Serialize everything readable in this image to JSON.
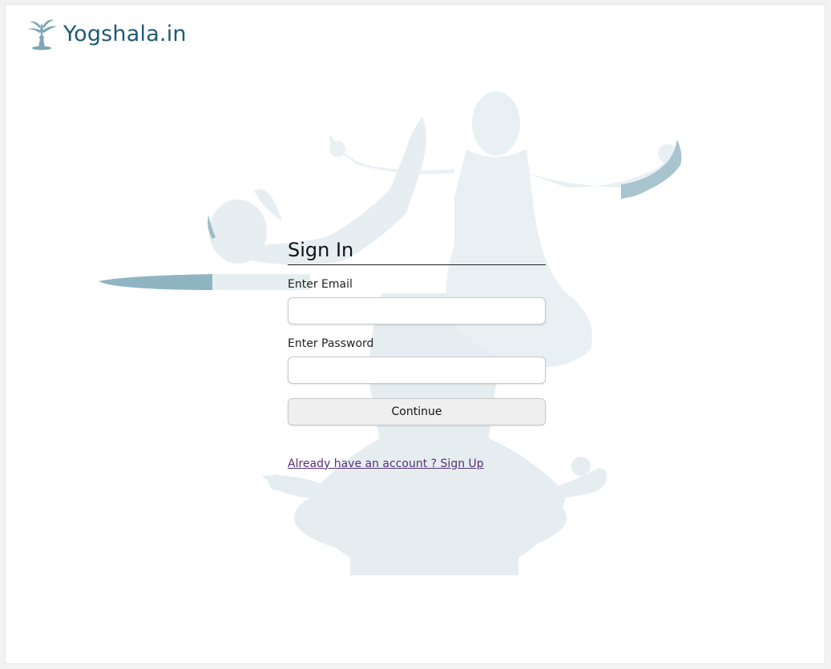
{
  "brand": {
    "name": "Yogshala.in",
    "logo_icon": "yoga-tree-logo-icon",
    "color": "#1f5a72"
  },
  "hero": {
    "illustration": "yoga-poses-silhouette",
    "colors": {
      "light": "#e3ebef",
      "accent": "#8fb5c3"
    }
  },
  "signin": {
    "title": "Sign In",
    "email_label": "Enter Email",
    "email_value": "",
    "password_label": "Enter Password",
    "password_value": "",
    "continue_label": "Continue",
    "signup_link": "Already have an account ? Sign Up"
  }
}
